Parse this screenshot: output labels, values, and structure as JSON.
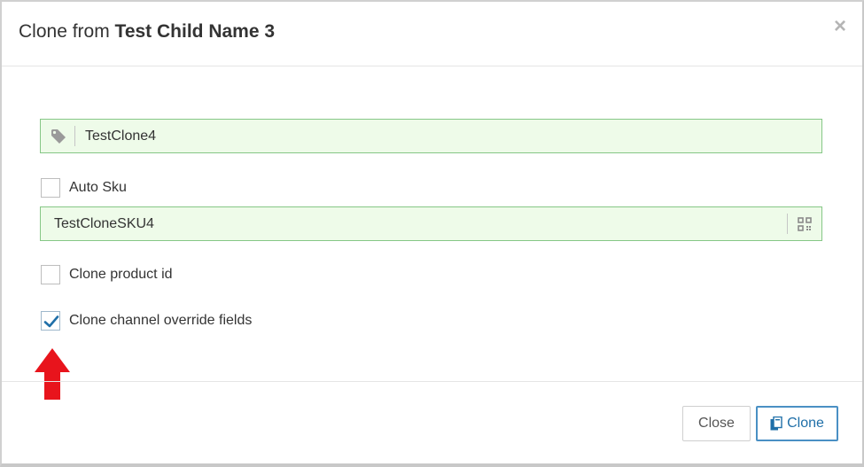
{
  "dialog": {
    "title_prefix": "Clone from",
    "title_name": "Test Child Name 3",
    "close_glyph": "×"
  },
  "fields": {
    "name_value": "TestClone4",
    "name_icon": "tag-icon",
    "sku_value": "TestCloneSKU4",
    "sku_icon": "qr-code-icon"
  },
  "options": {
    "auto_sku": {
      "label": "Auto Sku",
      "checked": false
    },
    "clone_product_id": {
      "label": "Clone product id",
      "checked": false
    },
    "clone_override": {
      "label": "Clone channel override fields",
      "checked": true
    }
  },
  "buttons": {
    "close_label": "Close",
    "clone_label": "Clone",
    "clone_icon": "copy-icon"
  },
  "colors": {
    "field_bg": "#eefbe9",
    "field_border": "#86c786",
    "primary": "#1f6fa8",
    "annotation_arrow": "#e8141c"
  }
}
